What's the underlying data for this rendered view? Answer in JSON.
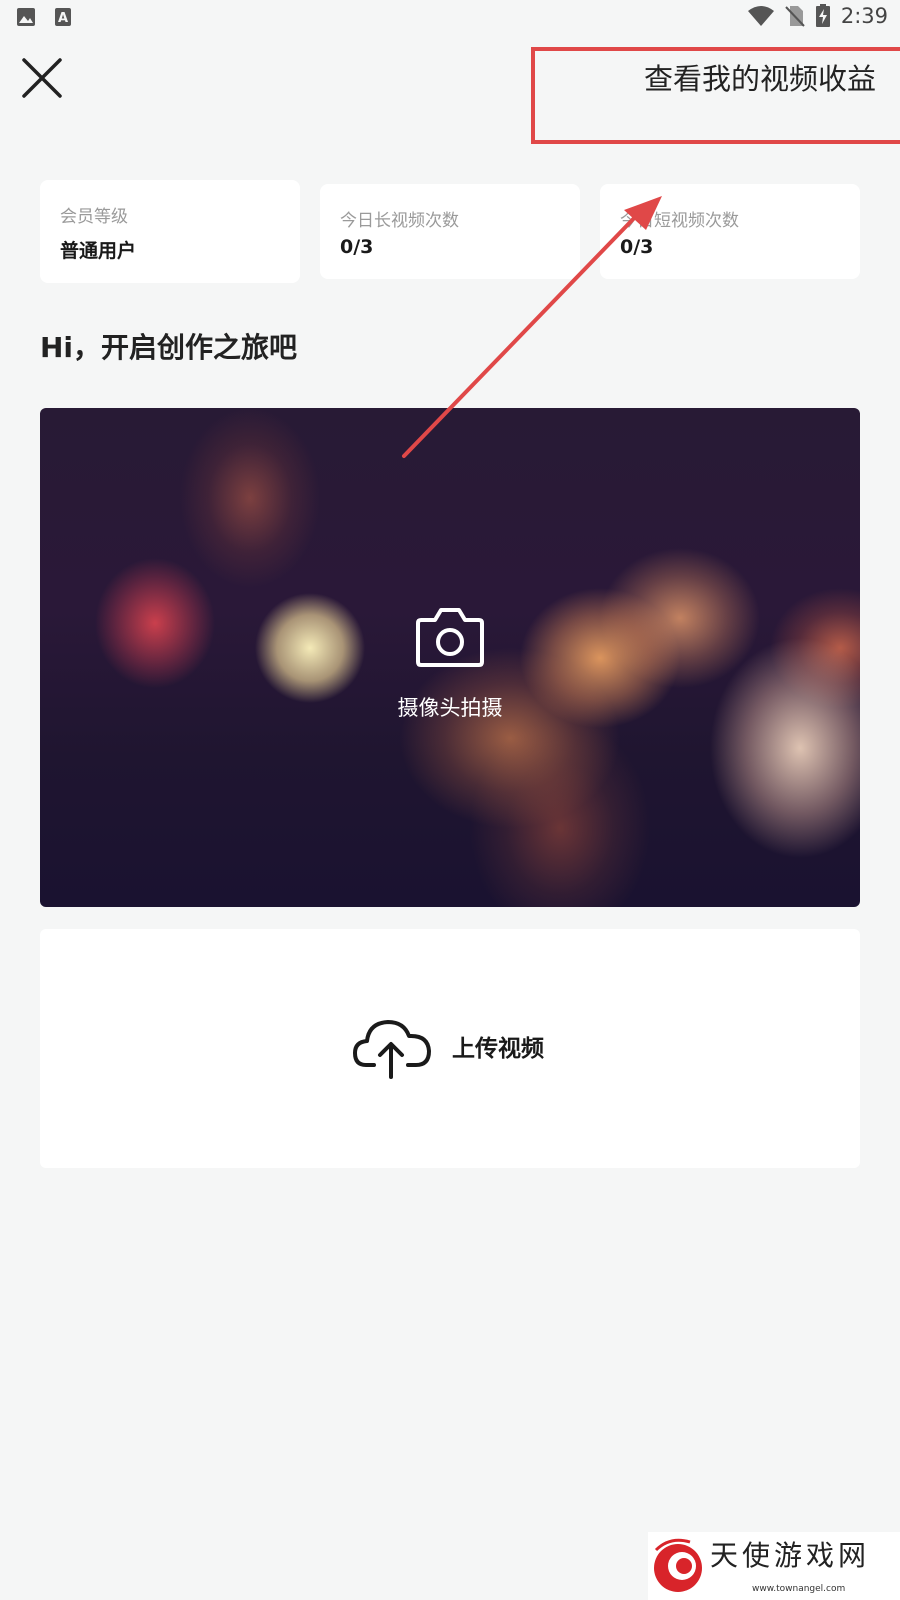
{
  "status_bar": {
    "time": "2:39",
    "left_icons": [
      "image-icon",
      "text-a-icon"
    ],
    "right_icons": [
      "wifi-icon",
      "no-sim-icon",
      "battery-charging-icon"
    ]
  },
  "top_bar": {
    "close_icon": "close-icon",
    "earnings_link": "查看我的视频收益"
  },
  "stats": [
    {
      "label": "会员等级",
      "value": "普通用户"
    },
    {
      "label": "今日长视频次数",
      "value": "0/3"
    },
    {
      "label": "今日短视频次数",
      "value": "0/3"
    }
  ],
  "greeting": "Hi，开启创作之旅吧",
  "camera": {
    "icon": "camera-icon",
    "label": "摄像头拍摄"
  },
  "upload": {
    "icon": "cloud-upload-icon",
    "label": "上传视频"
  },
  "annotation": {
    "color": "#e04848"
  },
  "watermark": {
    "text": "天使游戏网",
    "url": "www.townangel.com"
  }
}
